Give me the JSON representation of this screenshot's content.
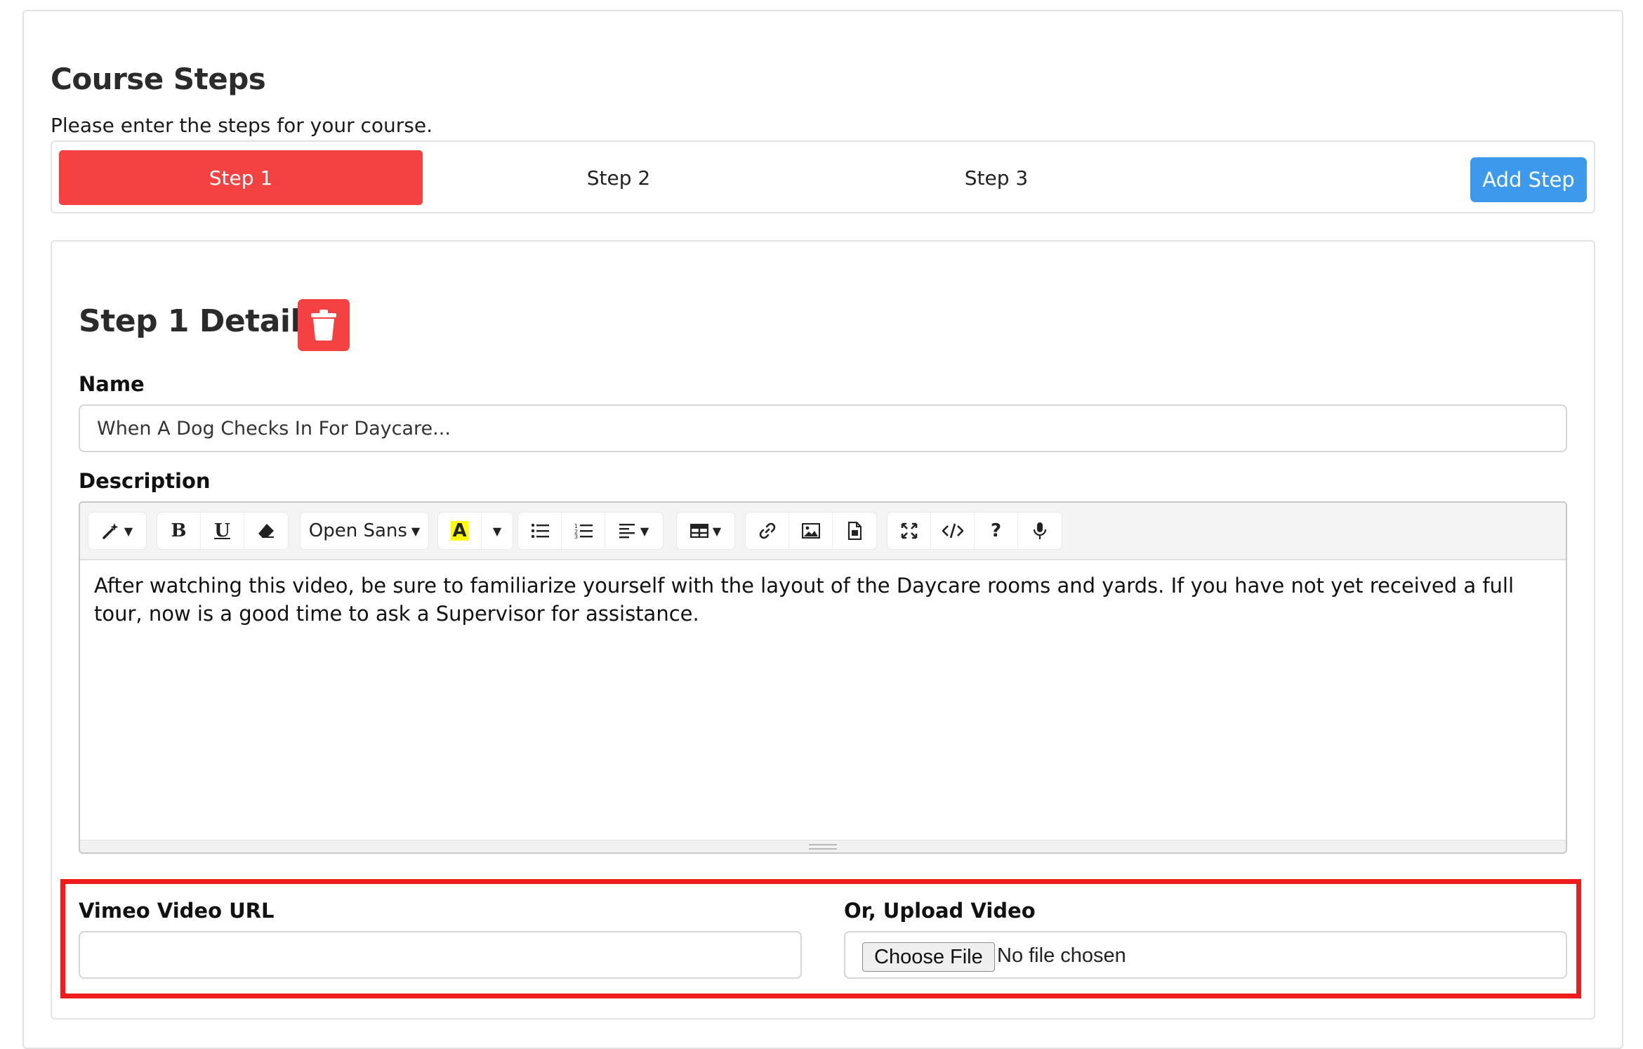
{
  "course_steps": {
    "title": "Course Steps",
    "subtitle": "Please enter the steps for your course.",
    "tabs": [
      {
        "label": "Step 1",
        "active": true
      },
      {
        "label": "Step 2",
        "active": false
      },
      {
        "label": "Step 3",
        "active": false
      }
    ],
    "add_step_label": "Add Step"
  },
  "step_details": {
    "title": "Step 1 Details",
    "delete_icon": "trash-icon",
    "name_label": "Name",
    "name_value": "When A Dog Checks In For Daycare...",
    "description_label": "Description",
    "toolbar": {
      "font_name": "Open Sans",
      "highlight_letter": "A",
      "help_glyph": "?"
    },
    "description_text": "After watching this video, be sure to familiarize yourself with the layout of the Daycare rooms and yards. If you have not yet received a full tour, now is a good time to ask a Supervisor for assistance."
  },
  "video": {
    "vimeo_label": "Vimeo Video URL",
    "vimeo_value": "",
    "upload_label": "Or, Upload Video",
    "choose_file_label": "Choose File",
    "no_file_text": "No file chosen"
  },
  "colors": {
    "active_tab": "#f44141",
    "add_step": "#3d99ec",
    "delete": "#f44141",
    "highlight_box": "#ee1c1c"
  }
}
